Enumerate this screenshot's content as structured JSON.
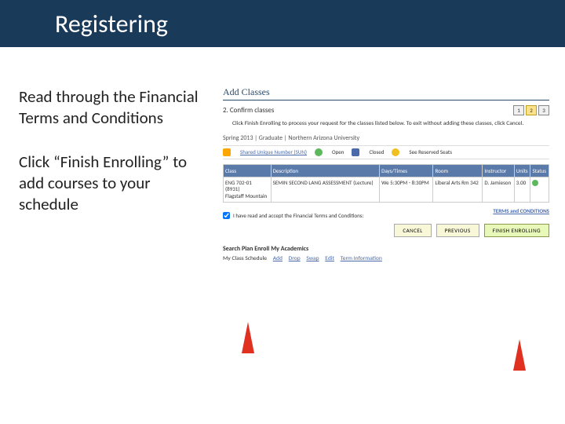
{
  "title": "Registering",
  "instructions": {
    "p1": "Read through the Financial Terms and Conditions",
    "p2": "Click “Finish Enrolling” to add courses to your schedule"
  },
  "panel": {
    "heading": "Add Classes",
    "step_label": "2. Confirm classes",
    "steps": [
      "1",
      "2",
      "3"
    ],
    "instr": "Click Finish Enrolling to process your request for the classes listed below. To exit without adding these classes, click Cancel.",
    "term": "Spring 2013 | Graduate | Northern Arizona University",
    "legend": {
      "sun": "Shared Unique Number (SUN)",
      "open": "Open",
      "closed": "Closed",
      "reserved": "See Reserved Seats"
    },
    "table": {
      "headers": [
        "Class",
        "Description",
        "Days/Times",
        "Room",
        "Instructor",
        "Units",
        "Status"
      ],
      "row": {
        "class": "ENG 702-01\n(8931)\nFlagstaff Mountain",
        "desc": "SEMIN SECOND LANG ASSESSMENT (Lecture)",
        "daytime": "We 5:30PM - 8:30PM",
        "room": "Liberal Arts Rm 342",
        "instr": "D. Jamieson",
        "units": "3.00"
      }
    },
    "checkbox_label": "I have read and accept the Financial Terms and Conditions:",
    "terms_link": "TERMS and CONDITIONS",
    "buttons": {
      "cancel": "CANCEL",
      "previous": "PREVIOUS",
      "finish": "FINISH ENROLLING"
    },
    "tabs": "Search  Plan  Enroll  My Academics",
    "subtabs": {
      "current": "My Class Schedule",
      "add": "Add",
      "drop": "Drop",
      "swap": "Swap",
      "edit": "Edit",
      "term": "Term Information"
    }
  }
}
